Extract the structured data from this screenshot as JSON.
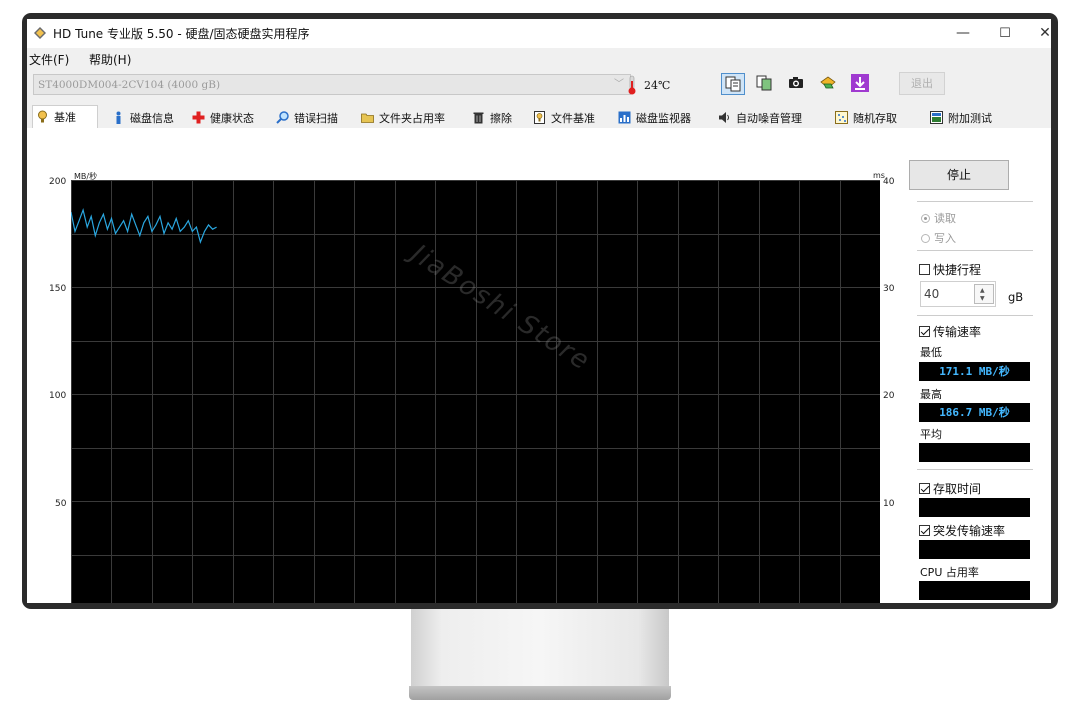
{
  "window": {
    "title": "HD Tune 专业版 5.50 - 硬盘/固态硬盘实用程序",
    "controls": {
      "minimize": "—",
      "maximize": "☐",
      "close": "✕"
    }
  },
  "menu": [
    "文件(F)",
    "帮助(H)"
  ],
  "toolbar": {
    "drive": "ST4000DM004-2CV104 (4000 gB)",
    "temperature": "24℃",
    "exit_label": "退出",
    "buttons": [
      "copy-text-icon",
      "copy-screenshot-icon",
      "camera-icon",
      "options-icon",
      "download-icon"
    ]
  },
  "tabs": [
    {
      "label": "基准",
      "icon": "benchmark-icon",
      "active": true
    },
    {
      "label": "磁盘信息",
      "icon": "info-icon"
    },
    {
      "label": "健康状态",
      "icon": "health-cross-icon"
    },
    {
      "label": "错误扫描",
      "icon": "magnifier-icon"
    },
    {
      "label": "文件夹占用率",
      "icon": "folder-icon"
    },
    {
      "label": "擦除",
      "icon": "trash-icon"
    },
    {
      "label": "文件基准",
      "icon": "file-benchmark-icon"
    },
    {
      "label": "磁盘监视器",
      "icon": "monitor-icon"
    },
    {
      "label": "自动噪音管理",
      "icon": "speaker-icon"
    },
    {
      "label": "随机存取",
      "icon": "random-access-icon"
    },
    {
      "label": "附加测试",
      "icon": "extra-tests-icon"
    }
  ],
  "side": {
    "stop_label": "停止",
    "read_label": "读取",
    "write_label": "写入",
    "mode_selected": "读取",
    "short_stroke_label": "快捷行程",
    "short_stroke_checked": false,
    "short_stroke_value": "40",
    "short_stroke_unit": "gB",
    "transfer_rate_label": "传输速率",
    "transfer_rate_checked": true,
    "min_label": "最低",
    "min_value": "171.1 MB/秒",
    "max_label": "最高",
    "max_value": "186.7 MB/秒",
    "avg_label": "平均",
    "avg_value": "",
    "access_time_label": "存取时间",
    "access_time_checked": true,
    "access_time_value": "",
    "burst_label": "突发传输速率",
    "burst_checked": true,
    "burst_value": "",
    "cpu_label": "CPU 占用率",
    "cpu_value": ""
  },
  "watermark": "JiaBoshi Store",
  "colors": {
    "chart_bg": "#000000",
    "grid": "#3a3a3a",
    "series": "#2aa7e0",
    "stat_text": "#44b8ff",
    "selected_tool": "#cfe4f7"
  },
  "chart_data": {
    "type": "line",
    "ylabel_left": "MB/秒",
    "ylabel_right": "ms",
    "y_ticks_left": [
      50,
      100,
      150,
      200
    ],
    "y_ticks_right": [
      10,
      20,
      30,
      40
    ],
    "ylim": [
      0,
      200
    ],
    "y2lim": [
      0,
      40
    ],
    "x_extent": [
      0,
      100
    ],
    "grid": true,
    "series": [
      {
        "x": [
          0,
          0.5,
          1.0,
          1.5,
          2.0,
          2.5,
          3.0,
          3.5,
          4.0,
          4.5,
          5.0,
          5.5,
          6.0,
          6.5,
          7.0,
          7.5,
          8.0,
          8.5,
          9.0,
          9.5,
          10.0,
          10.5,
          11.0,
          11.5,
          12.0,
          12.5,
          13.0,
          13.5,
          14.0,
          14.5,
          15.0,
          15.5,
          16.0,
          16.5,
          17.0,
          17.5,
          18.0
        ],
        "y": [
          185,
          176,
          181,
          186,
          178,
          183,
          174,
          180,
          184,
          177,
          182,
          175,
          178,
          181,
          176,
          184,
          179,
          174,
          180,
          183,
          176,
          179,
          183,
          175,
          180,
          177,
          182,
          176,
          178,
          181,
          176,
          178,
          171,
          176,
          179,
          177,
          178
        ]
      }
    ]
  }
}
